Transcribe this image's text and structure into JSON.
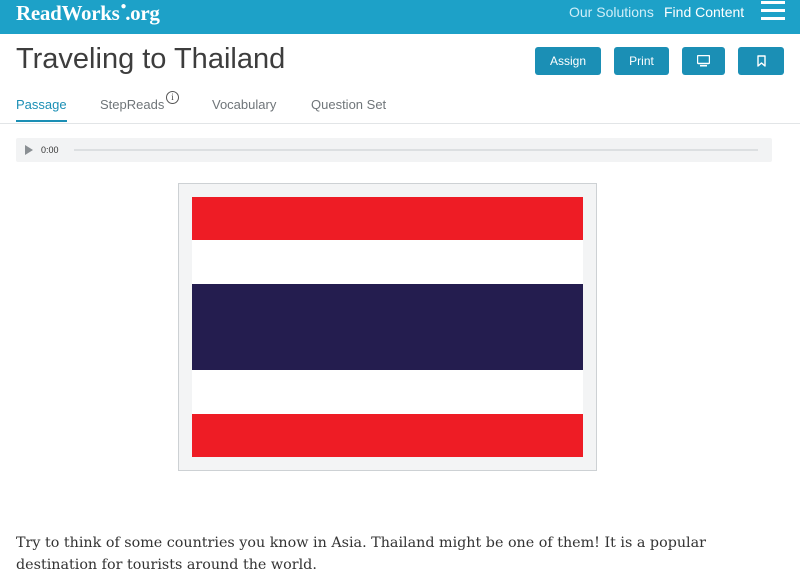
{
  "topbar": {
    "logo_text": "ReadWorks",
    "logo_suffix": ".org",
    "nav": [
      "Our Solutions",
      "Find Content"
    ],
    "bg_color": "#1da1c8"
  },
  "header": {
    "title": "Traveling to Thailand",
    "buttons": {
      "assign": "Assign",
      "print": "Print",
      "present_icon": "monitor-icon",
      "bookmark_icon": "bookmark-icon"
    }
  },
  "tabs": [
    {
      "label": "Passage",
      "active": true
    },
    {
      "label": "StepReads",
      "active": false,
      "info_icon": "i"
    },
    {
      "label": "Vocabulary",
      "active": false
    },
    {
      "label": "Question Set",
      "active": false
    }
  ],
  "audio": {
    "time": "0:00",
    "progress": 0
  },
  "image": {
    "subject": "Flag of Thailand",
    "colors": {
      "red": "#ee1c25",
      "white": "#ffffff",
      "blue": "#241d4f"
    }
  },
  "passage": {
    "text": "Try to think of some countries you know in Asia. Thailand might be one of them! It is a popular destination for tourists around the world."
  }
}
